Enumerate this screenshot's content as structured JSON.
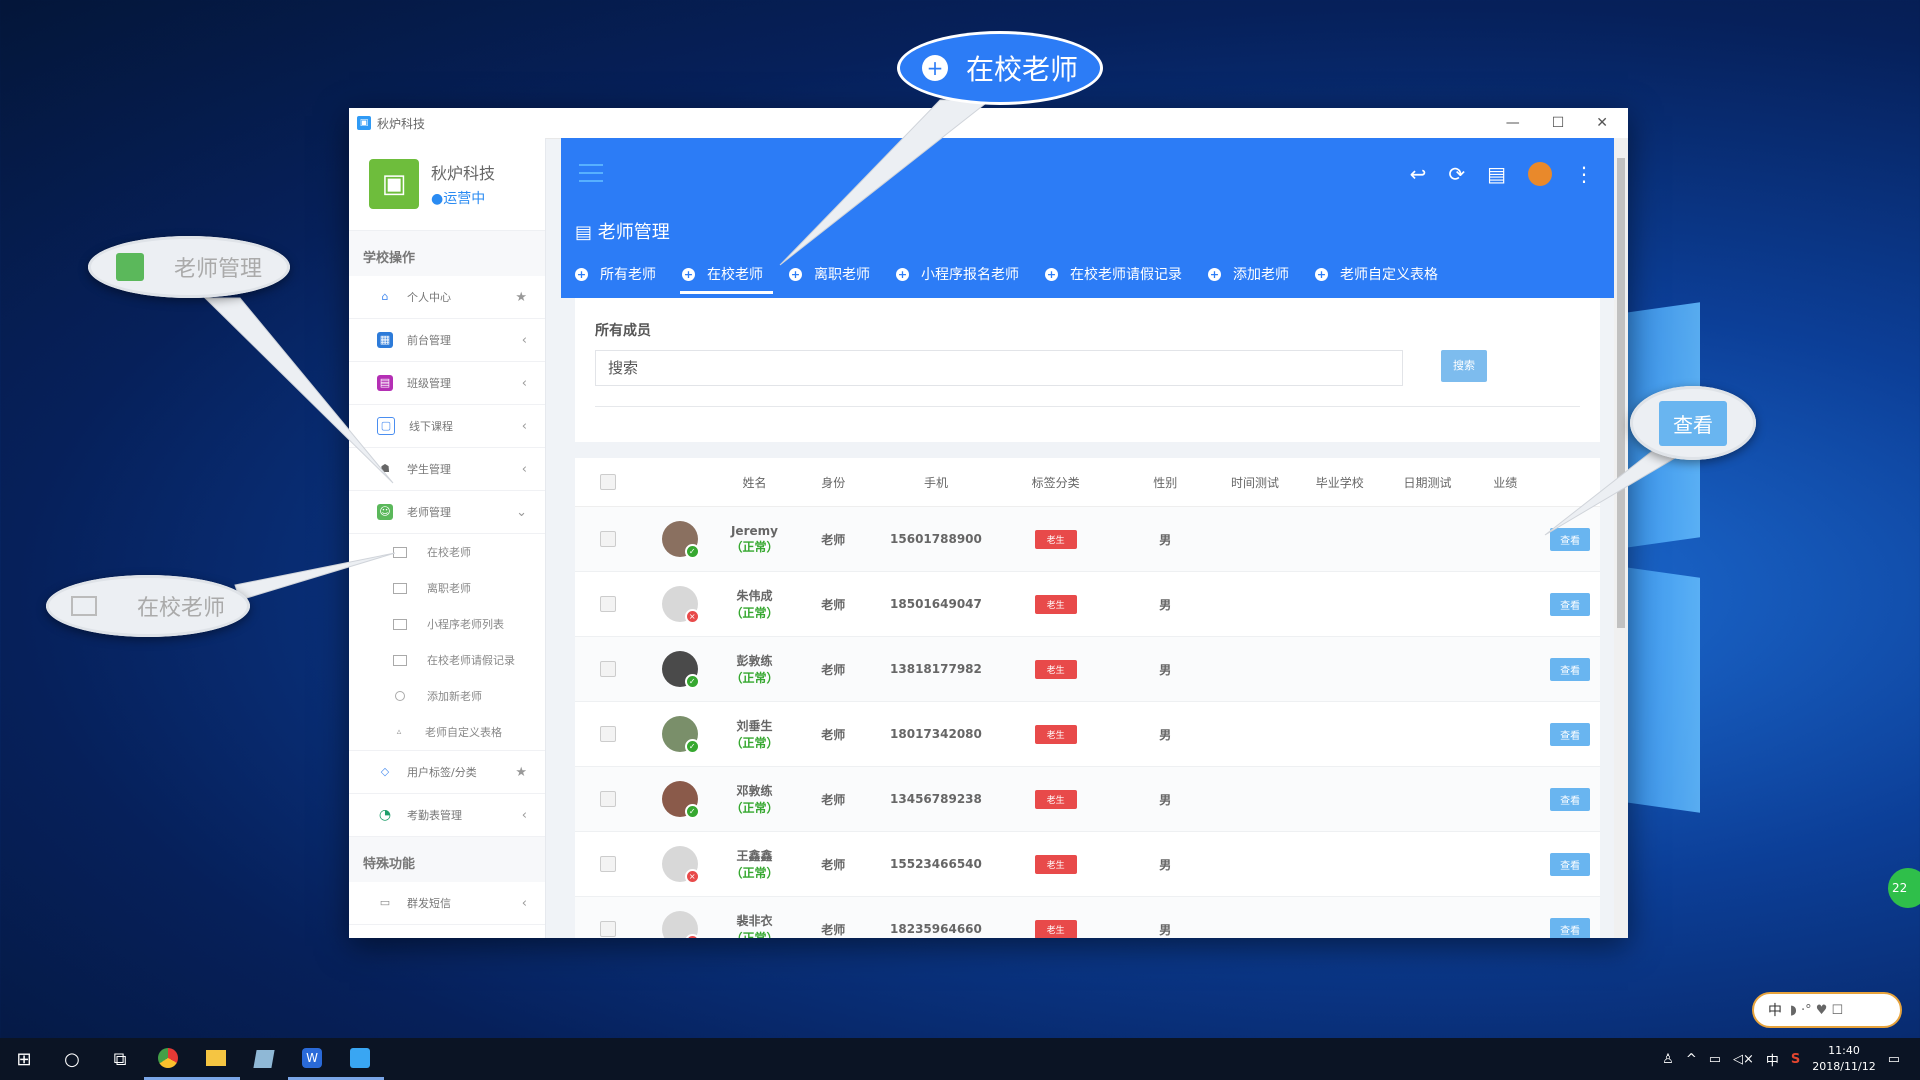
{
  "window": {
    "title": "秋炉科技"
  },
  "brand": {
    "name": "秋炉科技",
    "status": "●运营中"
  },
  "sidebar": {
    "section1": "学校操作",
    "items": [
      {
        "label": "个人中心",
        "icon": "home-icon",
        "right": "★"
      },
      {
        "label": "前台管理",
        "icon": "dashboard-icon",
        "right": "‹"
      },
      {
        "label": "班级管理",
        "icon": "class-icon",
        "right": "‹"
      },
      {
        "label": "线下课程",
        "icon": "calendar-icon",
        "right": "‹"
      },
      {
        "label": "学生管理",
        "icon": "student-icon",
        "right": "‹"
      },
      {
        "label": "老师管理",
        "icon": "teacher-icon",
        "right": "⌄"
      }
    ],
    "sub_items": [
      {
        "label": "在校老师"
      },
      {
        "label": "离职老师"
      },
      {
        "label": "小程序老师列表"
      },
      {
        "label": "在校老师请假记录"
      },
      {
        "label": "添加新老师"
      },
      {
        "label": "老师自定义表格"
      }
    ],
    "items2": [
      {
        "label": "用户标签/分类",
        "right": "★"
      },
      {
        "label": "考勤表管理",
        "right": "‹"
      }
    ],
    "section2": "特殊功能",
    "items3": [
      {
        "label": "群发短信",
        "right": "‹"
      }
    ]
  },
  "header": {
    "title": "老师管理",
    "tabs": [
      "所有老师",
      "在校老师",
      "离职老师",
      "小程序报名老师",
      "在校老师请假记录",
      "添加老师",
      "老师自定义表格"
    ]
  },
  "search": {
    "section_label": "所有成员",
    "placeholder": "搜索",
    "button": "搜索"
  },
  "table": {
    "columns": [
      "姓名",
      "身份",
      "手机",
      "标签分类",
      "性别",
      "时间测试",
      "毕业学校",
      "日期测试",
      "业绩"
    ],
    "rows": [
      {
        "name": "Jeremy",
        "status": "（正常）",
        "role": "老师",
        "phone": "15601788900",
        "tag": "老生",
        "sex": "男",
        "action": "查看",
        "online": true
      },
      {
        "name": "朱伟成",
        "status": "（正常）",
        "role": "老师",
        "phone": "18501649047",
        "tag": "老生",
        "sex": "男",
        "action": "查看",
        "online": false
      },
      {
        "name": "彭敦练",
        "status": "（正常）",
        "role": "老师",
        "phone": "13818177982",
        "tag": "老生",
        "sex": "男",
        "action": "查看",
        "online": true
      },
      {
        "name": "刘垂生",
        "status": "（正常）",
        "role": "老师",
        "phone": "18017342080",
        "tag": "老生",
        "sex": "男",
        "action": "查看",
        "online": true
      },
      {
        "name": "邓敦练",
        "status": "（正常）",
        "role": "老师",
        "phone": "13456789238",
        "tag": "老生",
        "sex": "男",
        "action": "查看",
        "online": true
      },
      {
        "name": "王鑫鑫",
        "status": "（正常）",
        "role": "老师",
        "phone": "15523466540",
        "tag": "老生",
        "sex": "男",
        "action": "查看",
        "online": false
      },
      {
        "name": "裴非衣",
        "status": "（正常）",
        "role": "老师",
        "phone": "18235964660",
        "tag": "老生",
        "sex": "男",
        "action": "查看",
        "online": false
      }
    ]
  },
  "callouts": {
    "top": "在校老师",
    "left1": "老师管理",
    "left2": "在校老师",
    "right": "查看"
  },
  "taskbar": {
    "ime": "中",
    "lang": "中",
    "time": "11:40",
    "date": "2018/11/12",
    "badge": "22"
  },
  "colors": {
    "header": "#2c7cf6",
    "tag": "#e84a4a",
    "view_button": "#69b5f0",
    "status": "#36a830",
    "brand_logo": "#6ebd3c"
  }
}
